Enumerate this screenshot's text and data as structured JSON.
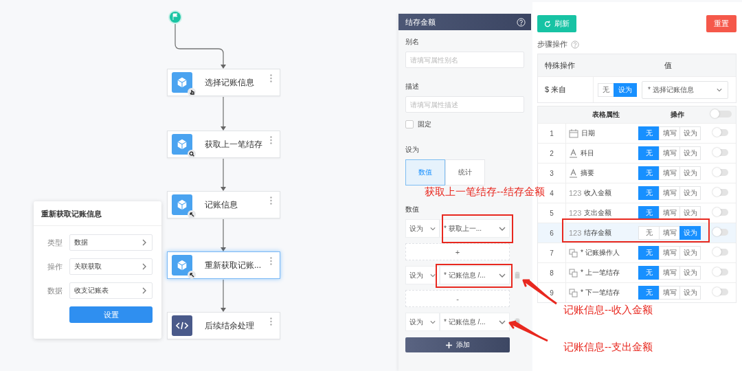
{
  "canvas": {
    "nodes": [
      {
        "label": "选择记账信息",
        "kind": "pick",
        "selected": false
      },
      {
        "label": "获取上一笔结存",
        "kind": "query",
        "selected": false
      },
      {
        "label": "记账信息",
        "kind": "link",
        "selected": false
      },
      {
        "label": "重新获取记账...",
        "kind": "link",
        "selected": true
      },
      {
        "label": "后续结余处理",
        "kind": "code",
        "selected": false
      }
    ],
    "popover": {
      "title": "重新获取记账信息",
      "fields": [
        {
          "label": "类型",
          "value": "数据"
        },
        {
          "label": "操作",
          "value": "关联获取"
        },
        {
          "label": "数据",
          "value": "收支记账表"
        }
      ],
      "button": "设置"
    }
  },
  "property_panel": {
    "title": "结存金额",
    "alias": {
      "label": "别名",
      "placeholder": "请填写属性别名"
    },
    "description": {
      "label": "描述",
      "placeholder": "请填写属性描述"
    },
    "fixed": {
      "label": "固定",
      "checked": false
    },
    "set_as": {
      "label": "设为",
      "options": [
        {
          "label": "数值",
          "selected": true
        },
        {
          "label": "统计",
          "selected": false
        }
      ]
    },
    "values": {
      "label": "数值",
      "items": [
        {
          "kind": "rule",
          "mode": "设为",
          "source": "* 获取上一...",
          "deletable": false
        },
        {
          "kind": "operator",
          "text": "+"
        },
        {
          "kind": "rule",
          "mode": "设为",
          "source": "* 记账信息 /...",
          "deletable": true
        },
        {
          "kind": "operator",
          "text": "-"
        },
        {
          "kind": "rule",
          "mode": "设为",
          "source": "* 记账信息 /...",
          "deletable": true
        }
      ],
      "add_button": "添加"
    }
  },
  "config_panel": {
    "refresh_button": "刷新",
    "reset_button": "重置",
    "steps_label": "步骤操作",
    "special": {
      "columns": [
        "特殊操作",
        "值"
      ],
      "row": {
        "name": "$ 来自",
        "options": [
          {
            "label": "无",
            "selected": false
          },
          {
            "label": "设为",
            "selected": true
          }
        ],
        "select": "* 选择记账信息"
      }
    },
    "attributes": {
      "columns": [
        "表格属性",
        "操作"
      ],
      "header_toggle": {
        "on": false
      },
      "rows": [
        {
          "index": "1",
          "kind": "date",
          "name": "日期",
          "selected": false,
          "toggle_on": false,
          "options": [
            {
              "label": "无",
              "selected": true
            },
            {
              "label": "填写",
              "selected": false
            },
            {
              "label": "设为",
              "selected": false
            }
          ]
        },
        {
          "index": "2",
          "kind": "text",
          "name": "科目",
          "selected": false,
          "toggle_on": false,
          "options": [
            {
              "label": "无",
              "selected": true
            },
            {
              "label": "填写",
              "selected": false
            },
            {
              "label": "设为",
              "selected": false
            }
          ]
        },
        {
          "index": "3",
          "kind": "text",
          "name": "摘要",
          "selected": false,
          "toggle_on": false,
          "options": [
            {
              "label": "无",
              "selected": true
            },
            {
              "label": "填写",
              "selected": false
            },
            {
              "label": "设为",
              "selected": false
            }
          ]
        },
        {
          "index": "4",
          "kind": "number",
          "type_mark": "123",
          "name": "收入金额",
          "selected": false,
          "toggle_on": false,
          "options": [
            {
              "label": "无",
              "selected": true
            },
            {
              "label": "填写",
              "selected": false
            },
            {
              "label": "设为",
              "selected": false
            }
          ]
        },
        {
          "index": "5",
          "kind": "number",
          "type_mark": "123",
          "name": "支出金额",
          "selected": false,
          "toggle_on": false,
          "options": [
            {
              "label": "无",
              "selected": true
            },
            {
              "label": "填写",
              "selected": false
            },
            {
              "label": "设为",
              "selected": false
            }
          ]
        },
        {
          "index": "6",
          "kind": "number",
          "type_mark": "123",
          "name": "结存金额",
          "selected": true,
          "toggle_on": false,
          "options": [
            {
              "label": "无",
              "selected": false
            },
            {
              "label": "填写",
              "selected": false
            },
            {
              "label": "设为",
              "selected": true
            }
          ]
        },
        {
          "index": "7",
          "kind": "relation",
          "name": "* 记账操作人",
          "selected": false,
          "toggle_on": false,
          "options": [
            {
              "label": "无",
              "selected": true
            },
            {
              "label": "填写",
              "selected": false
            },
            {
              "label": "设为",
              "selected": false
            }
          ]
        },
        {
          "index": "8",
          "kind": "relation",
          "name": "* 上一笔结存",
          "selected": false,
          "toggle_on": false,
          "options": [
            {
              "label": "无",
              "selected": true
            },
            {
              "label": "填写",
              "selected": false
            },
            {
              "label": "设为",
              "selected": false
            }
          ]
        },
        {
          "index": "9",
          "kind": "relation",
          "name": "* 下一笔结存",
          "selected": false,
          "toggle_on": false,
          "options": [
            {
              "label": "无",
              "selected": true
            },
            {
              "label": "填写",
              "selected": false
            },
            {
              "label": "设为",
              "selected": false
            }
          ]
        }
      ]
    }
  },
  "annotations": [
    "获取上一笔结存--结存金额",
    "记账信息--收入金额",
    "记账信息--支出金额"
  ]
}
